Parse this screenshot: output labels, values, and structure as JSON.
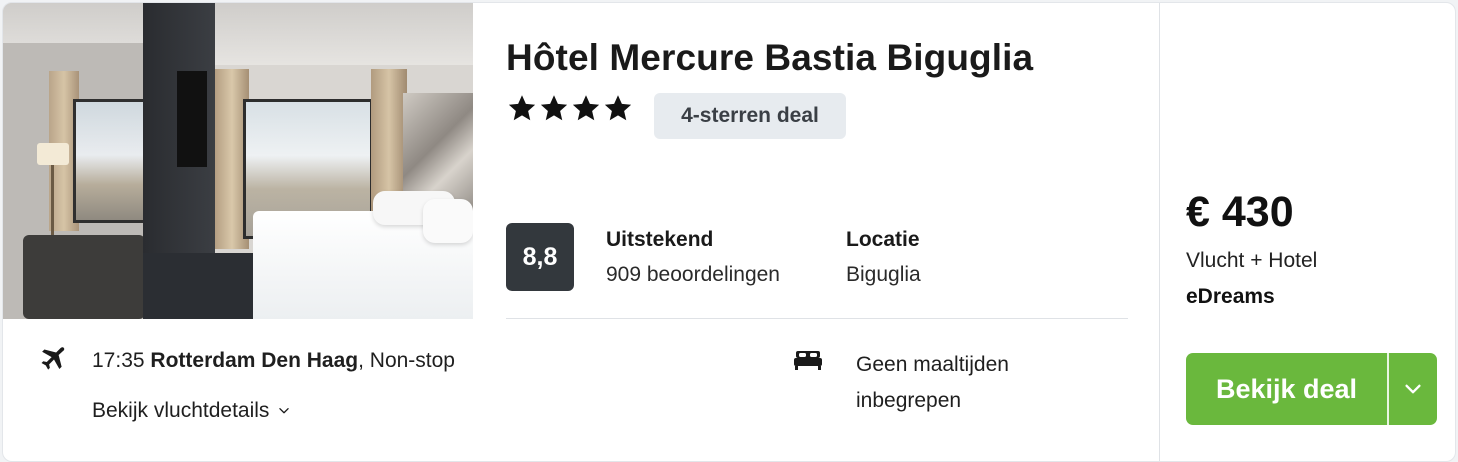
{
  "hotel": {
    "name": "Hôtel Mercure Bastia Biguglia",
    "stars": 4,
    "deal_badge": "4-sterren deal",
    "score": "8,8",
    "rating_label": "Uitstekend",
    "reviews": "909 beoordelingen",
    "location_label": "Locatie",
    "location_value": "Biguglia",
    "photo_icon": "hotel-room-photo"
  },
  "flight": {
    "time": "17:35",
    "airport": "Rotterdam Den Haag",
    "stops": ", Non-stop",
    "details_label": "Bekijk vluchtdetails",
    "icon": "plane-icon"
  },
  "meals": {
    "text": "Geen maaltijden inbegrepen",
    "icon": "bed-icon"
  },
  "price": {
    "amount": "€ 430",
    "type": "Vlucht + Hotel",
    "provider": "eDreams"
  },
  "cta": {
    "label": "Bekijk deal",
    "icon": "chevron-down-icon",
    "color": "#6ab83d"
  },
  "colors": {
    "score_bg": "#33383d",
    "badge_bg": "#e7ebef"
  }
}
